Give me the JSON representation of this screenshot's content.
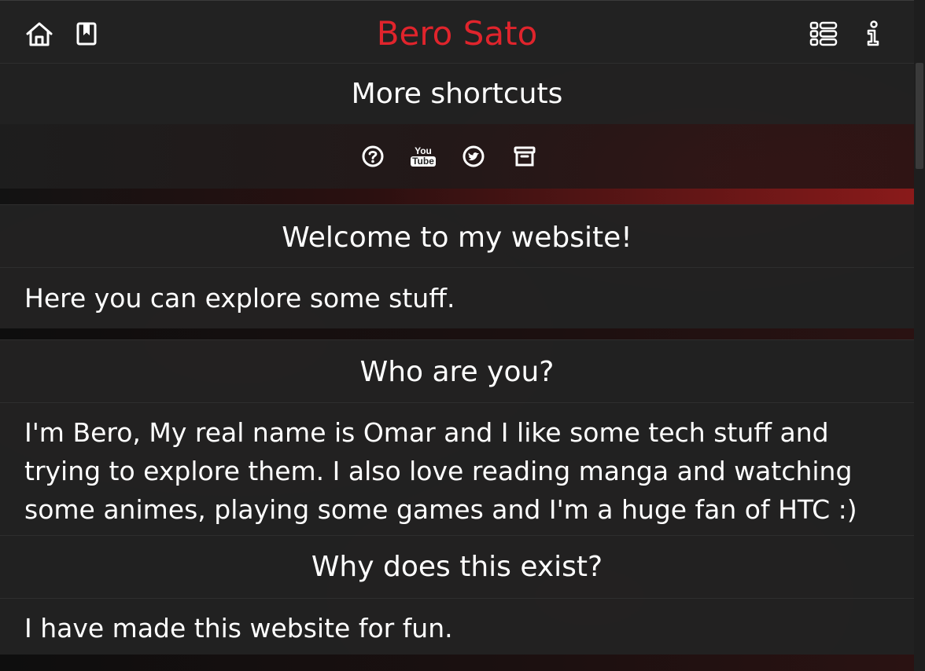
{
  "header": {
    "title": "Bero Sato",
    "left_icons": [
      "home-icon",
      "bookmark-icon"
    ],
    "right_icons": [
      "list-icon",
      "info-icon"
    ]
  },
  "shortcuts": {
    "heading": "More shortcuts",
    "icons": [
      "help-icon",
      "youtube-icon",
      "twitter-icon",
      "archive-icon"
    ],
    "youtube_top": "You",
    "youtube_bottom": "Tube"
  },
  "sections": [
    {
      "heading": "Welcome to my website!",
      "body": "Here you can explore some stuff."
    },
    {
      "heading": "Who are you?",
      "body": "I'm Bero, My real name is Omar and I like some tech stuff and trying to explore them. I also love reading manga and watching some animes, playing some games and I'm a huge fan of HTC :)"
    },
    {
      "heading": "Why does this exist?",
      "body": "I have made this website for fun."
    }
  ],
  "colors": {
    "accent": "#e0242c",
    "background": "#161616",
    "panel": "#222222",
    "text": "#ffffff"
  }
}
